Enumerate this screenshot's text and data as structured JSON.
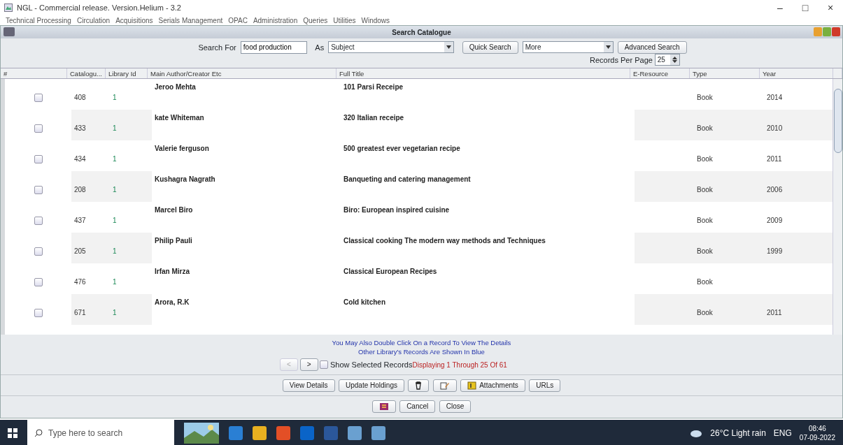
{
  "window": {
    "title": "NGL - Commercial release. Version.Helium - 3.2",
    "controls": [
      "–",
      "□",
      "×"
    ]
  },
  "menu": [
    "Technical Processing",
    "Circulation",
    "Acquisitions",
    "Serials Management",
    "OPAC",
    "Administration",
    "Queries",
    "Utilities",
    "Windows"
  ],
  "frame": {
    "title": "Search Catalogue"
  },
  "search": {
    "label": "Search For",
    "value": "food production",
    "as_label": "As",
    "as_value": "Subject",
    "quick": "Quick Search",
    "more": "More",
    "advanced": "Advanced Search",
    "rpp_label": "Records Per Page",
    "rpp_value": "25"
  },
  "table": {
    "columns": [
      "#",
      "Catalogu...",
      "Library Id",
      "Main Author/Creator Etc",
      "Full Title",
      "E-Resource",
      "Type",
      "Year"
    ],
    "rows": [
      {
        "checked": false,
        "catalogue": "408",
        "library_id": "1",
        "author": "Jeroo Mehta",
        "title": "101 Parsi Receipe",
        "type": "Book",
        "year": "2014"
      },
      {
        "checked": false,
        "catalogue": "433",
        "library_id": "1",
        "author": "kate Whiteman",
        "title": "320 Italian receipe",
        "type": "Book",
        "year": "2010"
      },
      {
        "checked": false,
        "catalogue": "434",
        "library_id": "1",
        "author": "Valerie ferguson",
        "title": "500 greatest ever vegetarian recipe",
        "type": "Book",
        "year": "2011"
      },
      {
        "checked": false,
        "catalogue": "208",
        "library_id": "1",
        "author": "Kushagra Nagrath",
        "title": "Banqueting and catering management",
        "type": "Book",
        "year": "2006"
      },
      {
        "checked": false,
        "catalogue": "437",
        "library_id": "1",
        "author": "Marcel Biro",
        "title": "Biro: European inspired cuisine",
        "type": "Book",
        "year": "2009"
      },
      {
        "checked": false,
        "catalogue": "205",
        "library_id": "1",
        "author": "Philip Pauli",
        "title": "Classical cooking The modern way methods and Techniques",
        "type": "Book",
        "year": "1999"
      },
      {
        "checked": false,
        "catalogue": "476",
        "library_id": "1",
        "author": "Irfan Mirza",
        "title": "Classical European Recipes",
        "type": "Book"
      },
      {
        "checked": false,
        "catalogue": "671",
        "library_id": "1",
        "author": "Arora, R.K",
        "title": "Cold kitchen",
        "type": "Book",
        "year": "2011"
      }
    ]
  },
  "hints": [
    "You May Also Double Click On a Record To View The Details",
    "Other Library's Records Are Shown In Blue"
  ],
  "pager": {
    "prev": {
      "label": "<",
      "disabled": true
    },
    "next": {
      "label": ">",
      "disabled": false
    },
    "show_selected": {
      "label": "Show Selected Records",
      "checked": false
    },
    "status": "Displaying 1 Through 25 Of 61"
  },
  "actions": [
    {
      "kind": "text",
      "label": "View Details"
    },
    {
      "kind": "text",
      "label": "Update Holdings"
    },
    {
      "kind": "trash"
    },
    {
      "kind": "edit"
    },
    {
      "kind": "attach",
      "label": "Attachments"
    },
    {
      "kind": "text",
      "label": "URLs"
    }
  ],
  "footer_buttons": [
    {
      "kind": "book"
    },
    {
      "kind": "text",
      "label": "Cancel"
    },
    {
      "kind": "text",
      "label": "Close"
    }
  ],
  "taskbar": {
    "search_placeholder": "Type here to search",
    "weather": "26°C  Light rain",
    "lang": "ENG",
    "time": "08:46",
    "date": "07-09-2022"
  }
}
